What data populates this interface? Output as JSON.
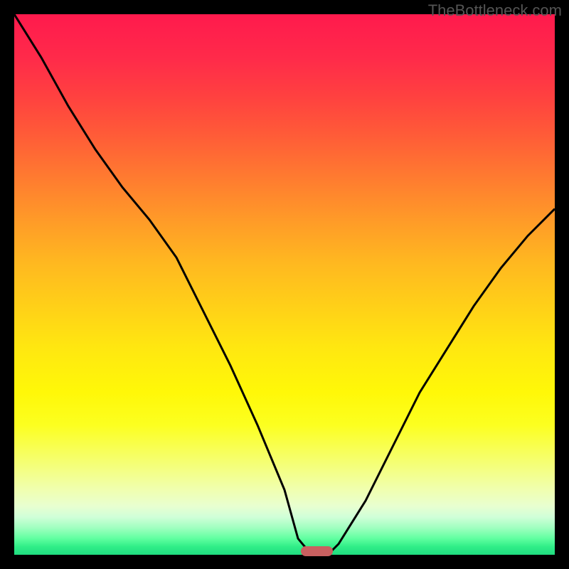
{
  "watermark": "TheBottleneck.com",
  "chart_data": {
    "type": "line",
    "title": "",
    "xlabel": "",
    "ylabel": "",
    "x": [
      0.0,
      0.05,
      0.1,
      0.15,
      0.2,
      0.25,
      0.3,
      0.35,
      0.4,
      0.45,
      0.5,
      0.525,
      0.55,
      0.58,
      0.6,
      0.65,
      0.7,
      0.75,
      0.8,
      0.85,
      0.9,
      0.95,
      1.0
    ],
    "values": [
      1.0,
      0.92,
      0.83,
      0.75,
      0.68,
      0.62,
      0.55,
      0.45,
      0.35,
      0.24,
      0.12,
      0.03,
      0.0,
      0.0,
      0.02,
      0.1,
      0.2,
      0.3,
      0.38,
      0.46,
      0.53,
      0.59,
      0.64
    ],
    "xlim": [
      0,
      1
    ],
    "ylim": [
      0,
      1
    ],
    "marker": {
      "x": 0.56,
      "width": 0.06,
      "y": 0.0
    }
  },
  "colors": {
    "curve": "#000000",
    "marker": "#c96060"
  }
}
